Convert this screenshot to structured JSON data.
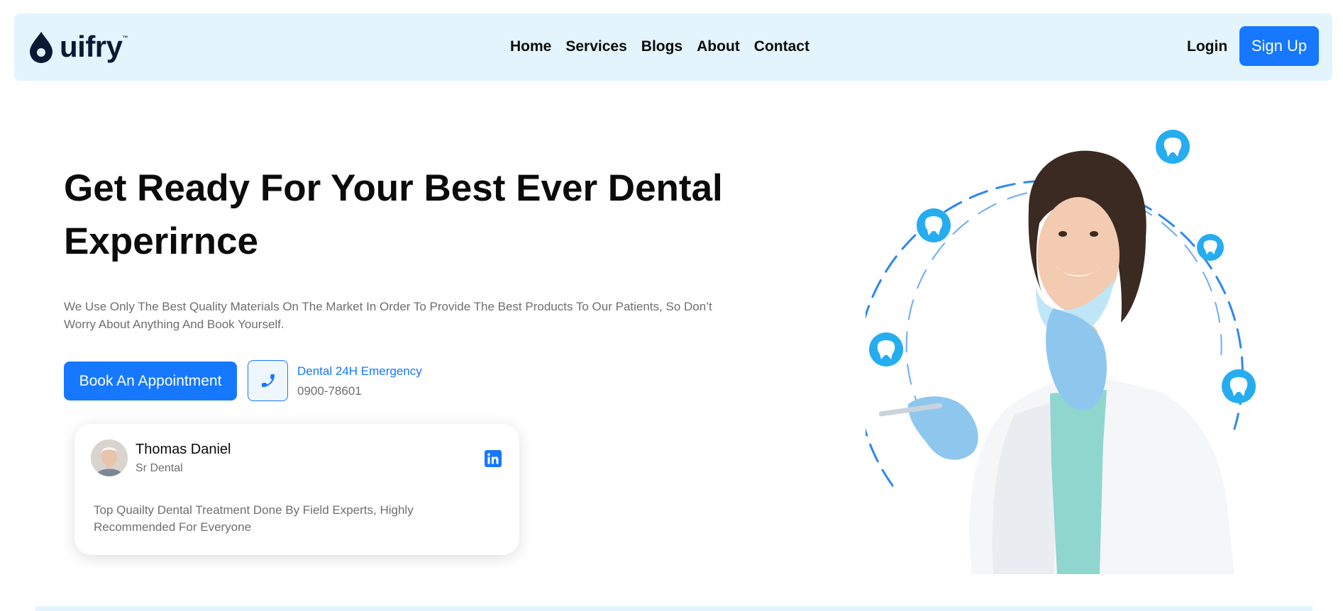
{
  "brand": {
    "name": "uifry",
    "tm": "™"
  },
  "nav": {
    "links": [
      "Home",
      "Services",
      "Blogs",
      "About",
      "Contact"
    ],
    "login": "Login",
    "signup": "Sign Up"
  },
  "hero": {
    "title": "Get Ready For Your Best Ever Dental Experirnce",
    "description": "We Use Only The Best Quality Materials On The Market In Order To Provide The Best Products To Our Patients, So Don’t Worry About Anything And Book Yourself.",
    "cta": "Book An Appointment",
    "emergency_label": "Dental 24H Emergency",
    "emergency_phone": "0900-78601"
  },
  "testimonial": {
    "name": "Thomas Daniel",
    "role": "Sr Dental",
    "text": "Top Quailty Dental Treatment Done By Field Experts, Highly Recommended For Everyone"
  },
  "colors": {
    "accent": "#1677ff",
    "nav_bg": "#e3f4fd",
    "tooth_badge": "#25adf0"
  },
  "icons": [
    "drop-logo-icon",
    "phone-icon",
    "linkedin-icon",
    "tooth-icon"
  ]
}
